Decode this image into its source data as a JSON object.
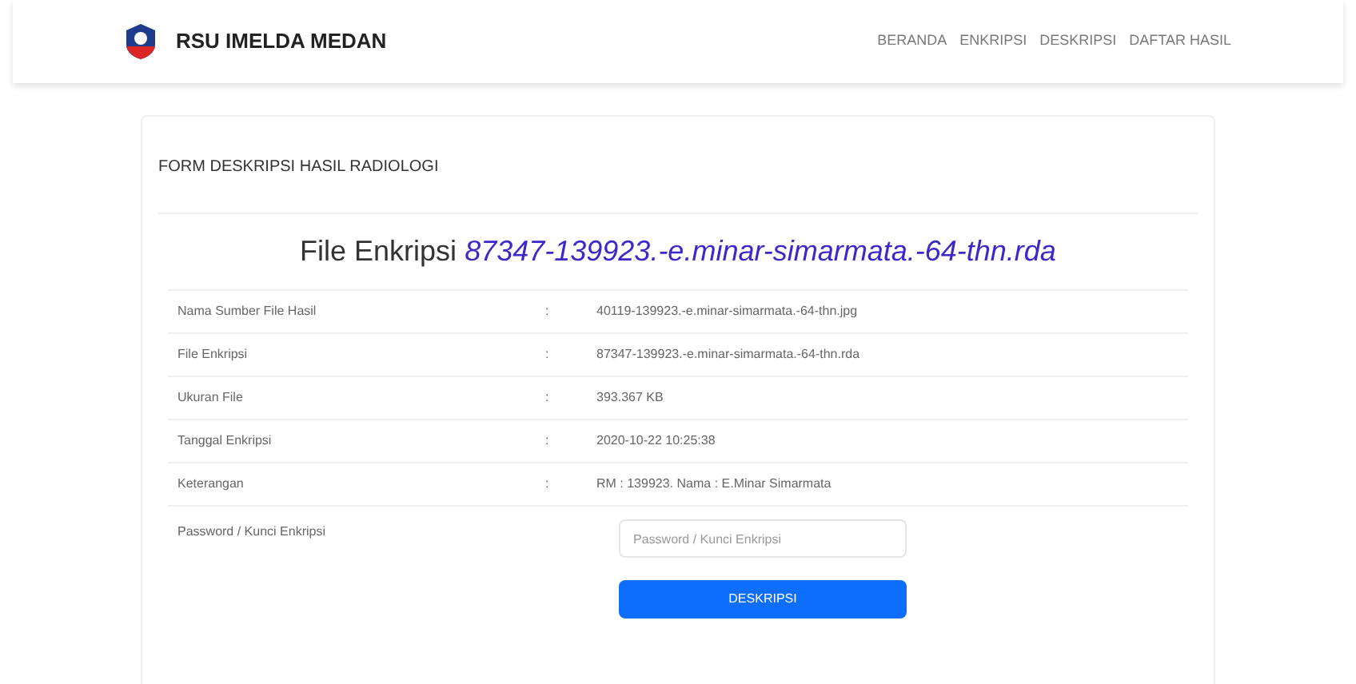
{
  "navbar": {
    "brand": "RSU IMELDA MEDAN",
    "links": [
      "BERANDA",
      "ENKRIPSI",
      "DESKRIPSI",
      "DAFTAR HASIL"
    ]
  },
  "card": {
    "header": "FORM DESKRIPSI HASIL RADIOLOGI",
    "title_label": "File Enkripsi",
    "title_file": "87347-139923.-e.minar-simarmata.-64-thn.rda",
    "rows": [
      {
        "label": "Nama Sumber File Hasil",
        "separator": ":",
        "value": "40119-139923.-e.minar-simarmata.-64-thn.jpg"
      },
      {
        "label": "File Enkripsi",
        "separator": ":",
        "value": "87347-139923.-e.minar-simarmata.-64-thn.rda"
      },
      {
        "label": "Ukuran File",
        "separator": ":",
        "value": "393.367 KB"
      },
      {
        "label": "Tanggal Enkripsi",
        "separator": ":",
        "value": "2020-10-22 10:25:38"
      },
      {
        "label": "Keterangan",
        "separator": ":",
        "value": "RM : 139923. Nama : E.Minar Simarmata"
      }
    ],
    "password": {
      "label": "Password / Kunci Enkripsi",
      "placeholder": "Password / Kunci Enkripsi"
    },
    "button": "DESKRIPSI"
  }
}
